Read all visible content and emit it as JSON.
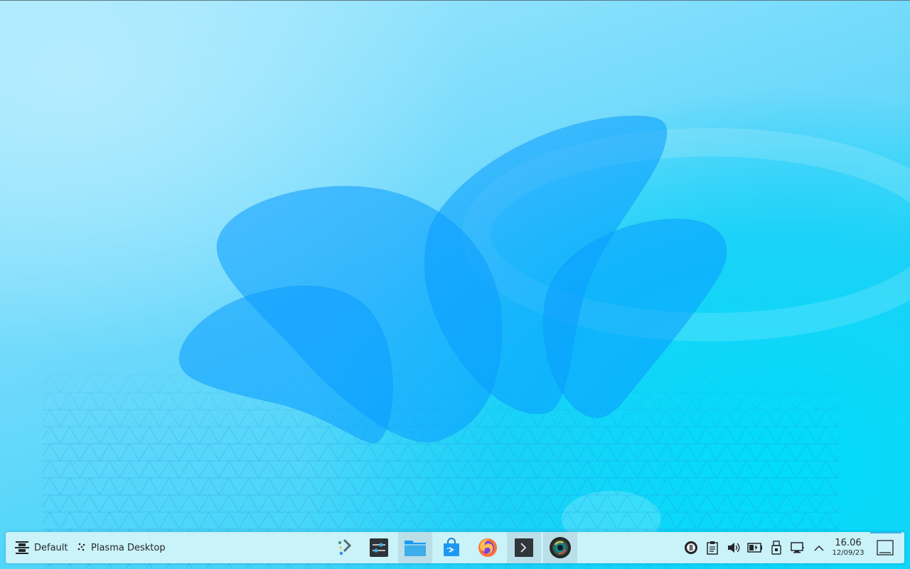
{
  "panel": {
    "activities_label": "Default",
    "desktop_label": "Plasma Desktop"
  },
  "taskbar": {
    "items": [
      {
        "name": "application-launcher",
        "icon": "kde-launcher-icon"
      },
      {
        "name": "system-settings",
        "icon": "settings-sliders-icon"
      },
      {
        "name": "dolphin",
        "icon": "folder-icon",
        "active": true
      },
      {
        "name": "discover",
        "icon": "shopping-bag-icon"
      },
      {
        "name": "firefox",
        "icon": "firefox-icon"
      },
      {
        "name": "konsole",
        "icon": "terminal-icon",
        "active": true
      },
      {
        "name": "camera",
        "icon": "camera-lens-icon",
        "active": true
      }
    ]
  },
  "tray": {
    "icons": [
      "updates-icon",
      "clipboard-icon",
      "volume-icon",
      "battery-icon",
      "usb-device-icon",
      "network-icon",
      "expand-tray-icon"
    ]
  },
  "clock": {
    "time": "16.06",
    "date": "12/09/23"
  },
  "colors": {
    "panel_bg": "#caf2f9",
    "petal": "#0a9dff"
  }
}
